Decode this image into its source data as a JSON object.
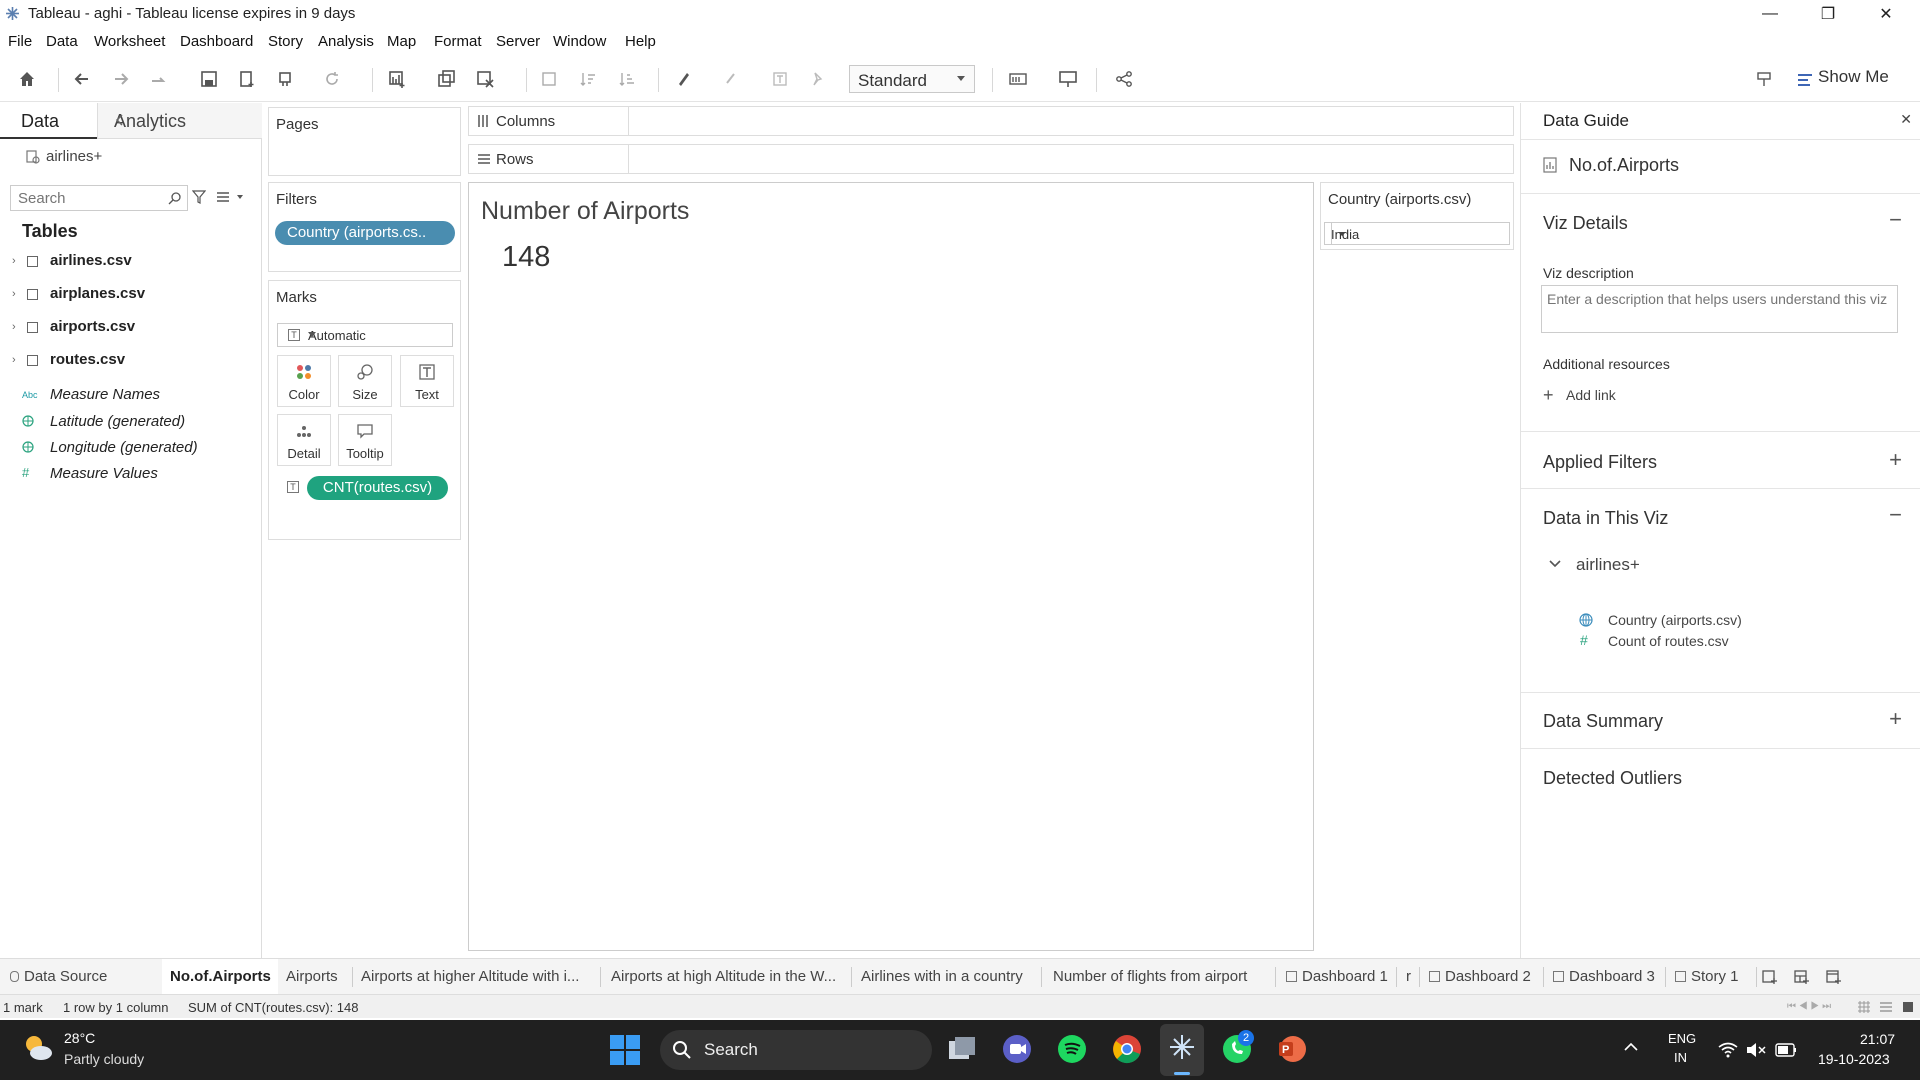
{
  "window": {
    "title": "Tableau - aghi - Tableau license expires in 9 days",
    "minimize": "—",
    "restore": "❐",
    "close": "✕"
  },
  "menu": [
    "File",
    "Data",
    "Worksheet",
    "Dashboard",
    "Story",
    "Analysis",
    "Map",
    "Format",
    "Server",
    "Window",
    "Help"
  ],
  "toolbar": {
    "fit_select": "Standard",
    "show_me": "Show Me"
  },
  "data_pane": {
    "tab_data": "Data",
    "tab_analytics": "Analytics",
    "datasource": "airlines+",
    "search_placeholder": "Search",
    "tables_heading": "Tables",
    "tables": [
      "airlines.csv",
      "airplanes.csv",
      "airports.csv",
      "routes.csv"
    ],
    "fields": [
      {
        "icon": "Abc",
        "name": "Measure Names"
      },
      {
        "icon": "globe",
        "name": "Latitude (generated)"
      },
      {
        "icon": "globe",
        "name": "Longitude (generated)"
      },
      {
        "icon": "#",
        "name": "Measure Values"
      }
    ]
  },
  "shelves": {
    "pages": "Pages",
    "filters": "Filters",
    "filter_pill": "Country (airports.cs..",
    "marks": "Marks",
    "mark_type": "Automatic",
    "mark_buttons": [
      "Color",
      "Size",
      "Text",
      "Detail",
      "Tooltip"
    ],
    "mark_pill": "CNT(routes.csv)",
    "columns": "Columns",
    "rows": "Rows"
  },
  "view": {
    "title": "Number of Airports",
    "value": "148"
  },
  "quick_filter": {
    "title": "Country (airports.csv)",
    "value": "India"
  },
  "data_guide": {
    "title": "Data Guide",
    "sheet": "No.of.Airports",
    "viz_details": "Viz Details",
    "viz_description_label": "Viz description",
    "viz_description_placeholder": "Enter a description that helps users understand this viz",
    "additional_resources": "Additional resources",
    "add_link": "Add link",
    "applied_filters": "Applied Filters",
    "data_in_viz": "Data in This Viz",
    "datasource": "airlines+",
    "fields": [
      "Country (airports.csv)",
      "Count of routes.csv"
    ],
    "data_summary": "Data Summary",
    "detected_outliers": "Detected Outliers"
  },
  "sheet_tabs": [
    "Data Source",
    "No.of.Airports",
    "Airports",
    "Airports at higher Altitude with i...",
    "Airports at high Altitude in the W...",
    "Airlines with in a country",
    "Number of flights from airport",
    "Dashboard 1",
    "r",
    "Dashboard 2",
    "Dashboard 3",
    "Story 1"
  ],
  "status": {
    "marks": "1 mark",
    "dims": "1 row by 1 column",
    "sum": "SUM of CNT(routes.csv): 148"
  },
  "taskbar": {
    "weather_temp": "28°C",
    "weather_desc": "Partly cloudy",
    "search": "Search",
    "lang": "ENG",
    "region": "IN",
    "time": "21:07",
    "date": "19-10-2023",
    "whatsapp_badge": "2"
  },
  "colors": {
    "filter_pill": "#4a8db0",
    "measure_pill": "#1fa37f",
    "taskbar": "#202020"
  }
}
